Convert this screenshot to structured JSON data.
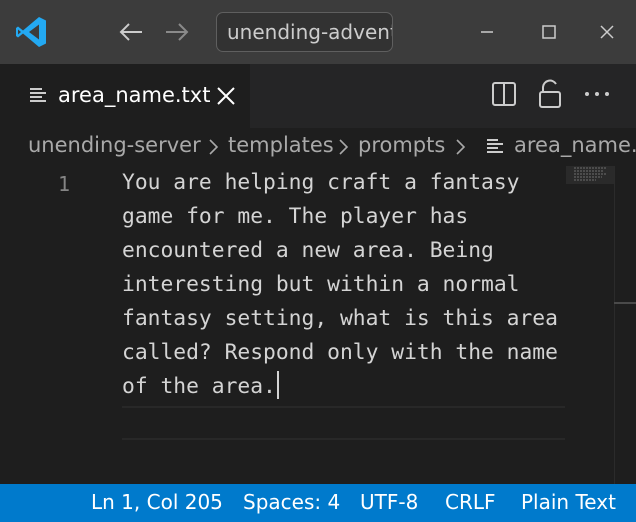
{
  "titlebar": {
    "app_icon": "vscode-logo",
    "back_icon": "arrow-left-icon",
    "forward_icon": "arrow-right-icon",
    "search_text": "unending-advent",
    "window_controls": [
      "minimize-icon",
      "maximize-icon",
      "close-icon"
    ]
  },
  "tabs": [
    {
      "label": "area_name.txt",
      "icon": "file-lines-icon",
      "active": true
    }
  ],
  "editor_actions": [
    "split-editor-icon",
    "lock-icon",
    "ellipsis-icon"
  ],
  "breadcrumb": {
    "items": [
      "unending-server",
      "templates",
      "prompts",
      "area_name.t"
    ],
    "separator_icon": "chevron-right-icon",
    "file_icon": "file-lines-icon"
  },
  "editor": {
    "line_number": "1",
    "content": "You are helping craft a fantasy game for me. The player has encountered a new area. Being interesting but within a normal fantasy setting, what is this area called? Respond only with the name of the area."
  },
  "statusbar": {
    "position": "Ln 1, Col 205",
    "indentation": "Spaces: 4",
    "encoding": "UTF-8",
    "eol": "CRLF",
    "language": "Plain Text"
  },
  "colors": {
    "titlebar": "#3c3c3c",
    "editor_bg": "#1e1e1e",
    "tabbar_bg": "#252526",
    "statusbar": "#007acc",
    "logo_blue": "#23a9f2"
  }
}
